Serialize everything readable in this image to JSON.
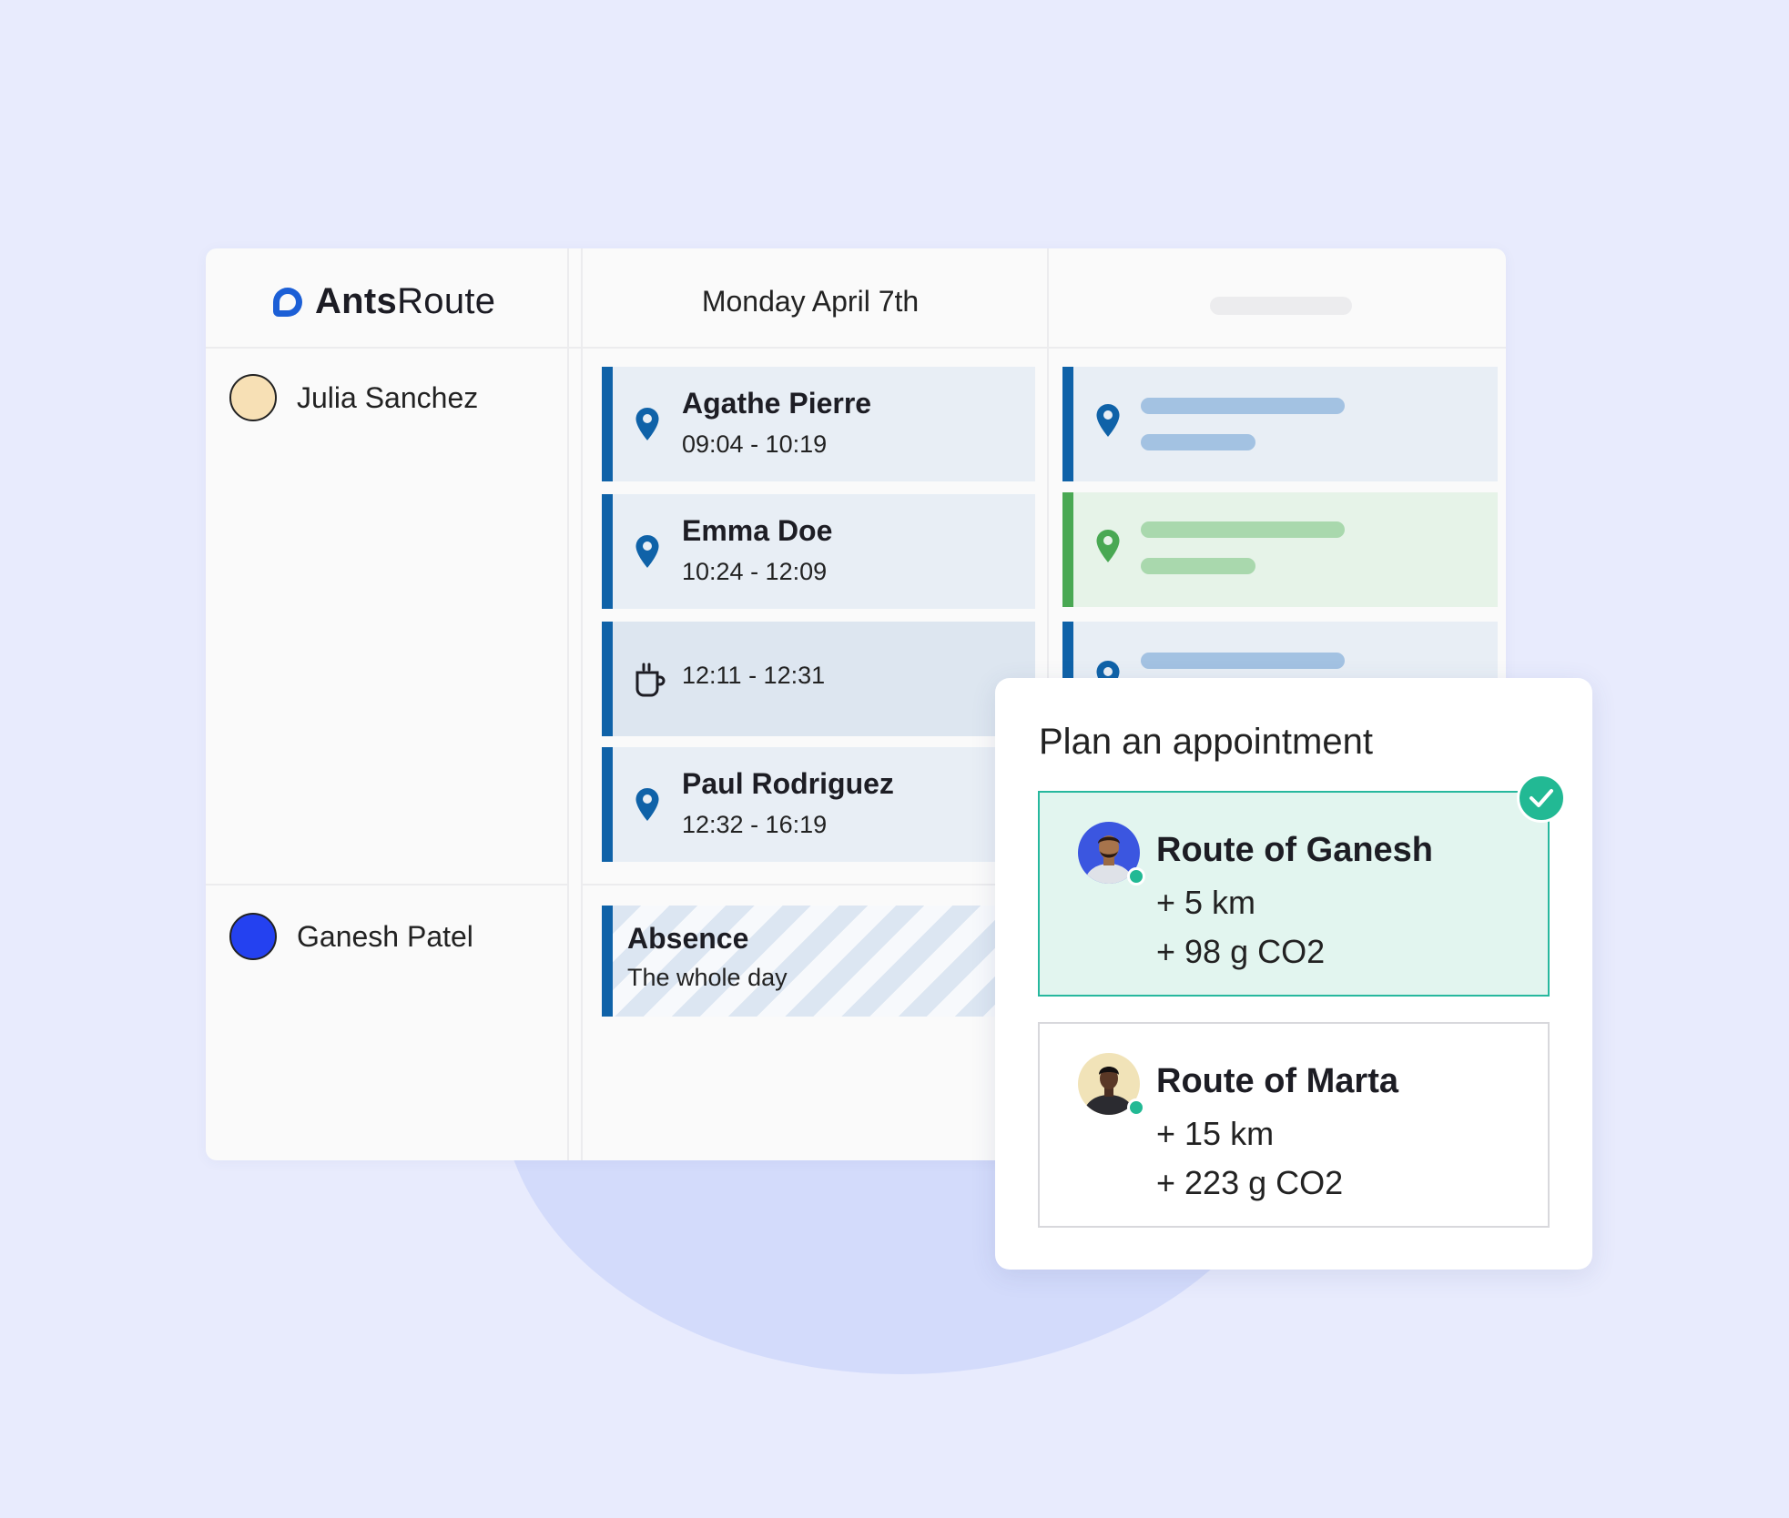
{
  "app": {
    "brand_bold": "Ants",
    "brand_light": "Route"
  },
  "header": {
    "date": "Monday April 7th"
  },
  "technicians": [
    {
      "name": "Julia Sanchez",
      "color": "#f7e0b5"
    },
    {
      "name": "Ganesh Patel",
      "color": "#2441f0"
    }
  ],
  "appointments": [
    {
      "title": "Agathe Pierre",
      "time": "09:04 - 10:19",
      "icon": "location-pin-icon"
    },
    {
      "title": "Emma Doe",
      "time": "10:24 - 12:09",
      "icon": "location-pin-icon"
    },
    {
      "title": "",
      "time": "12:11 - 12:31",
      "icon": "coffee-cup-icon"
    },
    {
      "title": "Paul Rodriguez",
      "time": "12:32 - 16:19",
      "icon": "location-pin-icon"
    }
  ],
  "absence": {
    "title": "Absence",
    "subtitle": "The whole day"
  },
  "plan": {
    "title": "Plan an appointment",
    "routes": [
      {
        "name": "Route of Ganesh",
        "distance": "+ 5 km",
        "co2": "+ 98 g CO2",
        "selected": true
      },
      {
        "name": "Route of Marta",
        "distance": "+ 15 km",
        "co2": "+ 223 g CO2",
        "selected": false
      }
    ]
  },
  "colors": {
    "accent_blue": "#0f62a8",
    "green": "#49a853",
    "selected_teal": "#22b994",
    "background": "#e8ebfd"
  }
}
